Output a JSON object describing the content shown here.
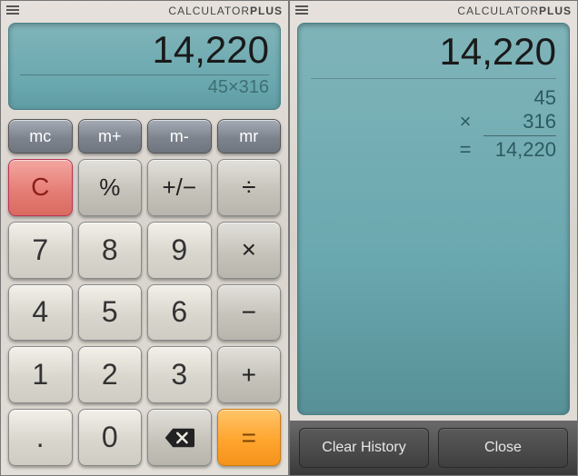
{
  "brand": {
    "prefix": "CALCULATOR",
    "suffix": "PLUS"
  },
  "display": {
    "result": "14,220",
    "expression": "45×316"
  },
  "memory": {
    "mc": "mc",
    "mplus": "m+",
    "mminus": "m-",
    "mr": "mr"
  },
  "ops": {
    "clear": "C",
    "percent": "%",
    "plusminus": "+/−",
    "divide": "÷",
    "multiply": "×",
    "minus": "−",
    "plus": "+",
    "equals": "=",
    "dot": "."
  },
  "nums": {
    "n0": "0",
    "n1": "1",
    "n2": "2",
    "n3": "3",
    "n4": "4",
    "n5": "5",
    "n6": "6",
    "n7": "7",
    "n8": "8",
    "n9": "9"
  },
  "history": {
    "result": "14,220",
    "op1": "45",
    "operator": "×",
    "op2": "316",
    "eq": "=",
    "answer": "14,220"
  },
  "buttons": {
    "clear_history": "Clear History",
    "close": "Close"
  }
}
